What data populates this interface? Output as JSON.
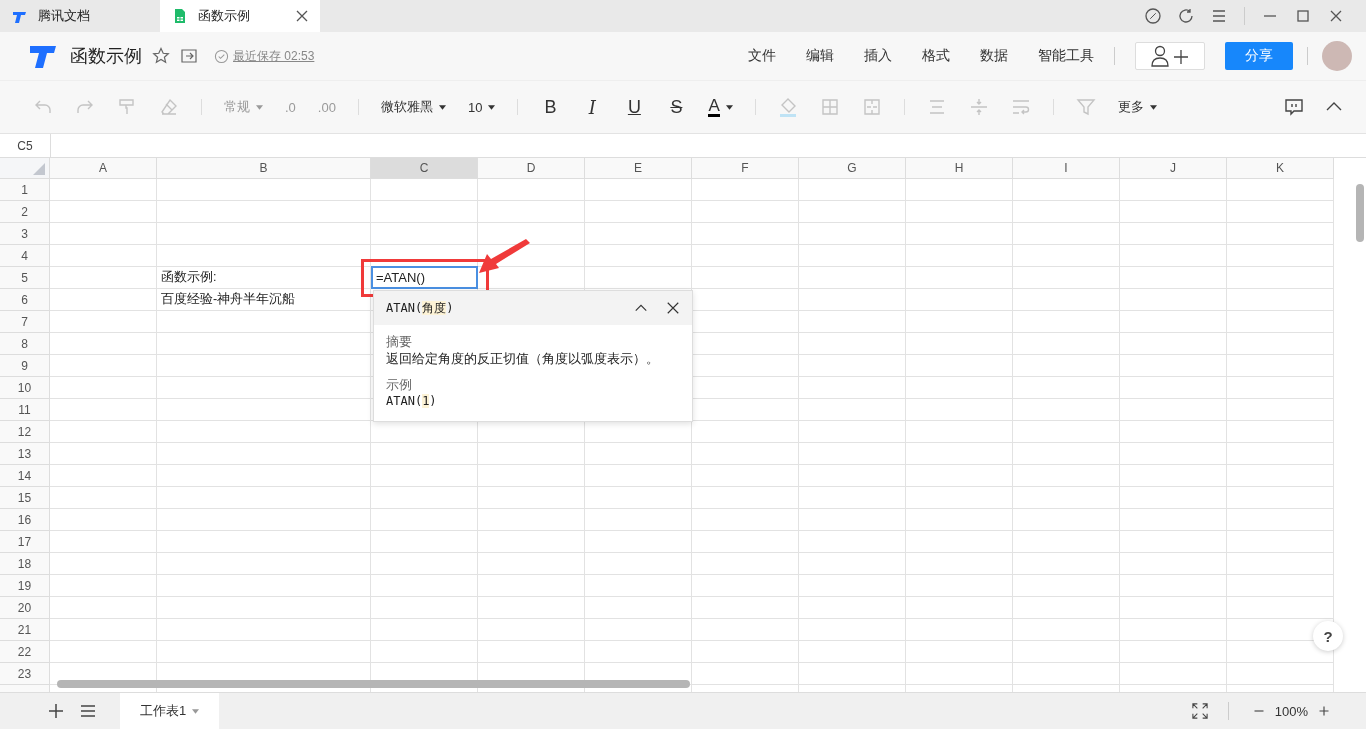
{
  "browser_tabs": [
    {
      "title": "腾讯文档",
      "kind": "docs",
      "selected": false
    },
    {
      "title": "函数示例",
      "kind": "sheet",
      "selected": true,
      "closable": true
    }
  ],
  "header": {
    "title": "函数示例",
    "save_status": "最近保存 02:53",
    "menu": [
      "文件",
      "编辑",
      "插入",
      "格式",
      "数据",
      "智能工具"
    ],
    "share_button": "分享"
  },
  "toolbar": [
    {
      "kind": "undo",
      "disabled": true
    },
    {
      "kind": "redo",
      "disabled": true
    },
    {
      "kind": "painter",
      "disabled": true
    },
    {
      "kind": "eraser",
      "disabled": true
    },
    {
      "kind": "separator"
    },
    {
      "kind": "dropdown",
      "label": "常规",
      "disabled": true
    },
    {
      "kind": "textbtn",
      "label": ".0",
      "disabled": true
    },
    {
      "kind": "textbtn",
      "label": ".00",
      "disabled": true
    },
    {
      "kind": "separator"
    },
    {
      "kind": "dropdown",
      "label": "微软雅黑",
      "disabled": false
    },
    {
      "kind": "dropdown",
      "label": "10",
      "disabled": false
    },
    {
      "kind": "separator"
    },
    {
      "kind": "bold",
      "label": "B",
      "disabled": false
    },
    {
      "kind": "italic",
      "label": "I",
      "disabled": false
    },
    {
      "kind": "underline",
      "label": "U",
      "disabled": false
    },
    {
      "kind": "strike",
      "label": "S",
      "disabled": false
    },
    {
      "kind": "fontcolor",
      "label": "A",
      "color": "#000000",
      "disabled": false
    },
    {
      "kind": "separator"
    },
    {
      "kind": "fill",
      "color": "#bfe3f5",
      "disabled": true
    },
    {
      "kind": "borders",
      "disabled": true
    },
    {
      "kind": "merge",
      "disabled": true
    },
    {
      "kind": "separator"
    },
    {
      "kind": "align",
      "disabled": true
    },
    {
      "kind": "valign",
      "disabled": true
    },
    {
      "kind": "wrap",
      "disabled": true
    },
    {
      "kind": "separator"
    },
    {
      "kind": "filter",
      "disabled": true
    },
    {
      "kind": "dropdown",
      "label": "更多",
      "disabled": false
    }
  ],
  "name_box": "C5",
  "columns": [
    {
      "label": "A",
      "selected": false
    },
    {
      "label": "B",
      "selected": false
    },
    {
      "label": "C",
      "selected": true
    },
    {
      "label": "D",
      "selected": false
    },
    {
      "label": "E",
      "selected": false
    },
    {
      "label": "F",
      "selected": false
    },
    {
      "label": "G",
      "selected": false
    },
    {
      "label": "H",
      "selected": false
    },
    {
      "label": "I",
      "selected": false
    },
    {
      "label": "J",
      "selected": false
    },
    {
      "label": "K",
      "selected": false
    }
  ],
  "rows": [
    {
      "header": "1"
    },
    {
      "header": "2"
    },
    {
      "header": "3"
    },
    {
      "header": "4"
    },
    {
      "header": "5",
      "cells": [
        null,
        {
          "text": "函数示例:",
          "editing": false
        },
        {
          "text": "=ATAN()",
          "editing": true
        }
      ]
    },
    {
      "header": "6",
      "cells": [
        null,
        {
          "text": "百度经验-神舟半年沉船",
          "editing": false
        }
      ]
    },
    {
      "header": "7"
    },
    {
      "header": "8"
    },
    {
      "header": "9"
    },
    {
      "header": "10"
    },
    {
      "header": "11"
    },
    {
      "header": "12"
    },
    {
      "header": "13"
    },
    {
      "header": "14"
    },
    {
      "header": "15"
    },
    {
      "header": "16"
    },
    {
      "header": "17"
    },
    {
      "header": "18"
    },
    {
      "header": "19"
    },
    {
      "header": "20"
    },
    {
      "header": "21"
    },
    {
      "header": "22"
    },
    {
      "header": "23"
    }
  ],
  "function_help": {
    "signature": {
      "before": "ATAN(",
      "param": "角度",
      "after": ")"
    },
    "summary_label": "摘要",
    "summary": "返回给定角度的反正切值（角度以弧度表示）。",
    "example_label": "示例",
    "example": {
      "before": "ATAN(",
      "param": "1",
      "after": ")"
    }
  },
  "sheet_tabs": [
    {
      "label": "工作表1",
      "selected": true
    }
  ],
  "zoom": "100%",
  "help_button": "?"
}
